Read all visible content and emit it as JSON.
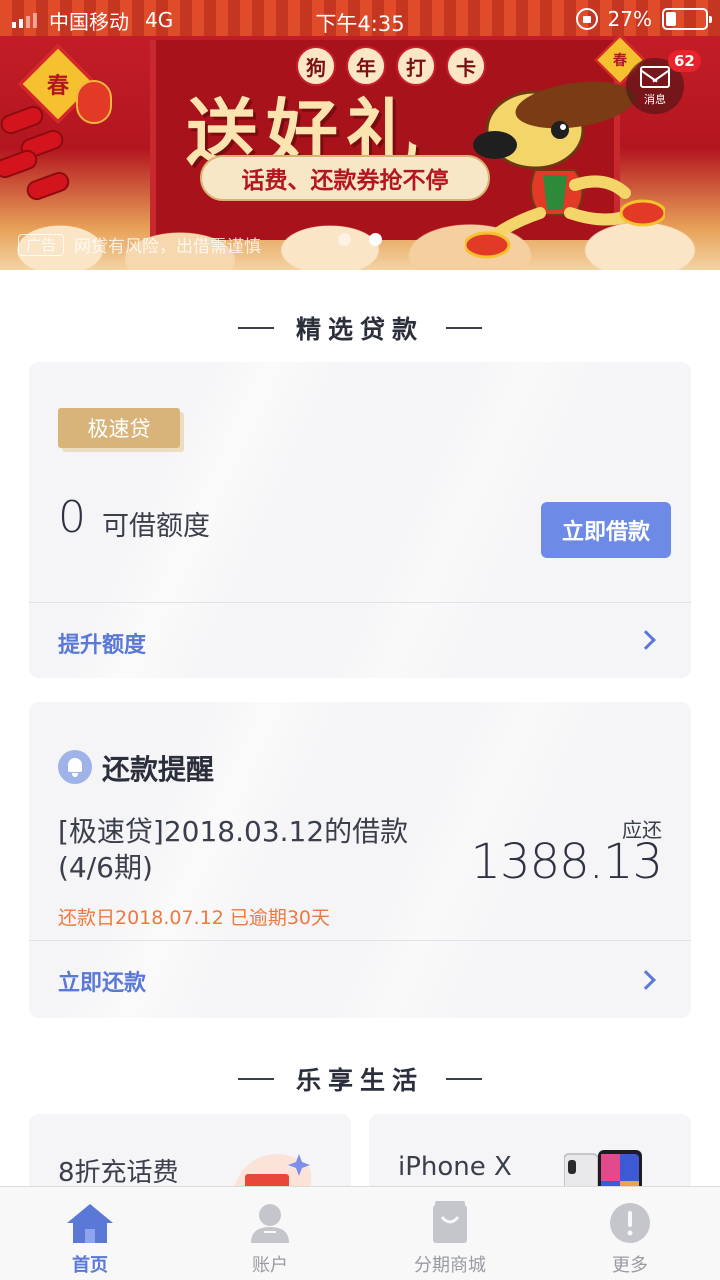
{
  "status_bar": {
    "carrier": "中国移动",
    "network": "4G",
    "time": "下午4:35",
    "battery": "27%",
    "battery_level": 0.27
  },
  "banner": {
    "corner_badge": "春",
    "tags": [
      "狗",
      "年",
      "打",
      "卡"
    ],
    "headline": "送好礼",
    "ribbon": "话费、还款券抢不停",
    "ad_label": "广告",
    "risk_notice": "网贷有风险，出借需谨慎",
    "slide_count": 2,
    "active_slide": 1
  },
  "message": {
    "label": "消息",
    "badge_count": "62"
  },
  "loans_section": {
    "title": "精选贷款"
  },
  "loan_card": {
    "product_badge": "极速贷",
    "available_amount": "0",
    "available_label": "可借额度",
    "borrow_button": "立即借款",
    "raise_limit_link": "提升额度"
  },
  "reminder_card": {
    "title": "还款提醒",
    "loan_description": "[极速贷]2018.03.12的借款(4/6期)",
    "due_label": "应还",
    "due_amount": "1388.13",
    "overdue_text": "还款日2018.07.12 已逾期30天",
    "repay_link": "立即还款"
  },
  "life_section": {
    "title": "乐享生活",
    "cards": [
      {
        "label": "8折充话费"
      },
      {
        "label": "iPhone X"
      }
    ]
  },
  "tab_bar": {
    "tabs": [
      {
        "label": "首页",
        "icon": "home-icon",
        "active": true
      },
      {
        "label": "账户",
        "icon": "account-icon",
        "active": false
      },
      {
        "label": "分期商城",
        "icon": "shopping-bag-icon",
        "active": false
      },
      {
        "label": "更多",
        "icon": "more-icon",
        "active": false
      }
    ]
  },
  "colors": {
    "accent": "#5a78d6",
    "button": "#6d8be6",
    "gold_badge": "#d8b47a",
    "overdue": "#f0783b",
    "message_badge": "#e8232b"
  }
}
